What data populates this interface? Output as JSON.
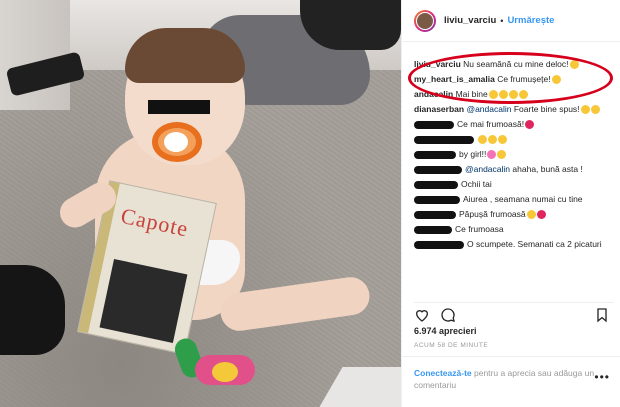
{
  "header": {
    "username": "liviu_varciu",
    "separator": "•",
    "follow_label": "Urmărește"
  },
  "book": {
    "title": "Capote"
  },
  "comments": [
    {
      "user": "liviu_varciu",
      "text": "Nu seamănă cu mine deloc!",
      "emoji": [
        "yellow"
      ]
    },
    {
      "user": "my_heart_is_amalia",
      "text": "Ce frumușețe!",
      "emoji": [
        "yellow"
      ]
    },
    {
      "user": "andacalin",
      "text": "Mai bine",
      "emoji": [
        "yellow",
        "yellow",
        "yellow",
        "yellow"
      ]
    },
    {
      "user": "dianaserban",
      "mention": "@andacalin",
      "text": "Foarte bine spus!",
      "emoji": [
        "yellow",
        "yellow"
      ]
    },
    {
      "user": "",
      "text": "Ce mai frumoasă!",
      "emoji": [
        "red"
      ]
    },
    {
      "user": "",
      "text": "",
      "emoji": [
        "yellow",
        "yellow",
        "yellow"
      ]
    },
    {
      "user": "",
      "text": "by girl!!",
      "emoji": [
        "pink",
        "yellow"
      ]
    },
    {
      "user": "",
      "mention": "@andacalin",
      "text": "ahaha, bună asta !",
      "emoji": []
    },
    {
      "user": "",
      "text": "Ochii tai",
      "emoji": []
    },
    {
      "user": "",
      "text": "Aiurea , seamana numai cu tine",
      "emoji": []
    },
    {
      "user": "",
      "text": "Păpușă frumoasă",
      "emoji": [
        "yellow",
        "red"
      ]
    },
    {
      "user": "",
      "text": "Ce frumoasa",
      "emoji": []
    },
    {
      "user": "",
      "text": "O scumpete. Semanati ca 2 picaturi",
      "emoji": []
    }
  ],
  "likes": "6.974 aprecieri",
  "time": "ACUM 58 DE MINUTE",
  "login": {
    "link": "Conectează-te",
    "rest": " pentru a aprecia sau adăuga un comentariu"
  },
  "more_label": "•••",
  "icons": [
    "heart-icon",
    "comment-icon",
    "bookmark-icon",
    "more-options-icon"
  ],
  "colors": {
    "accent": "#3897f0",
    "highlight": "#d6001c"
  }
}
